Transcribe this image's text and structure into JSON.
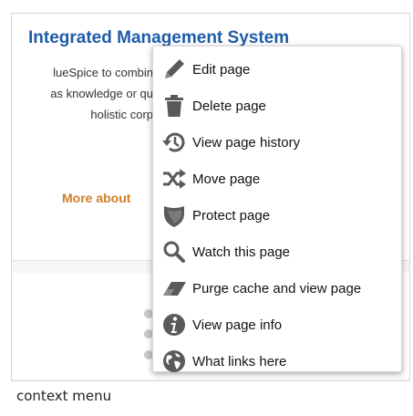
{
  "page": {
    "title": "Integrated Management System",
    "body_lines": [
      "lueSpice to combin",
      "as knowledge or qu",
      "holistic corp"
    ],
    "more_link": "More about"
  },
  "context_menu": {
    "items": [
      {
        "label": "Edit page",
        "icon": "pencil-icon"
      },
      {
        "label": "Delete page",
        "icon": "trash-icon"
      },
      {
        "label": "View page history",
        "icon": "history-icon"
      },
      {
        "label": "Move page",
        "icon": "shuffle-icon"
      },
      {
        "label": "Protect page",
        "icon": "shield-icon"
      },
      {
        "label": "Watch this page",
        "icon": "magnifier-icon"
      },
      {
        "label": "Purge cache and view page",
        "icon": "eraser-icon"
      },
      {
        "label": "View page info",
        "icon": "info-icon"
      },
      {
        "label": "What links here",
        "icon": "globe-icon"
      }
    ]
  },
  "caption": "context menu",
  "colors": {
    "title": "#1f5ca8",
    "link": "#d27d2a",
    "icon": "#5a5a5a"
  }
}
